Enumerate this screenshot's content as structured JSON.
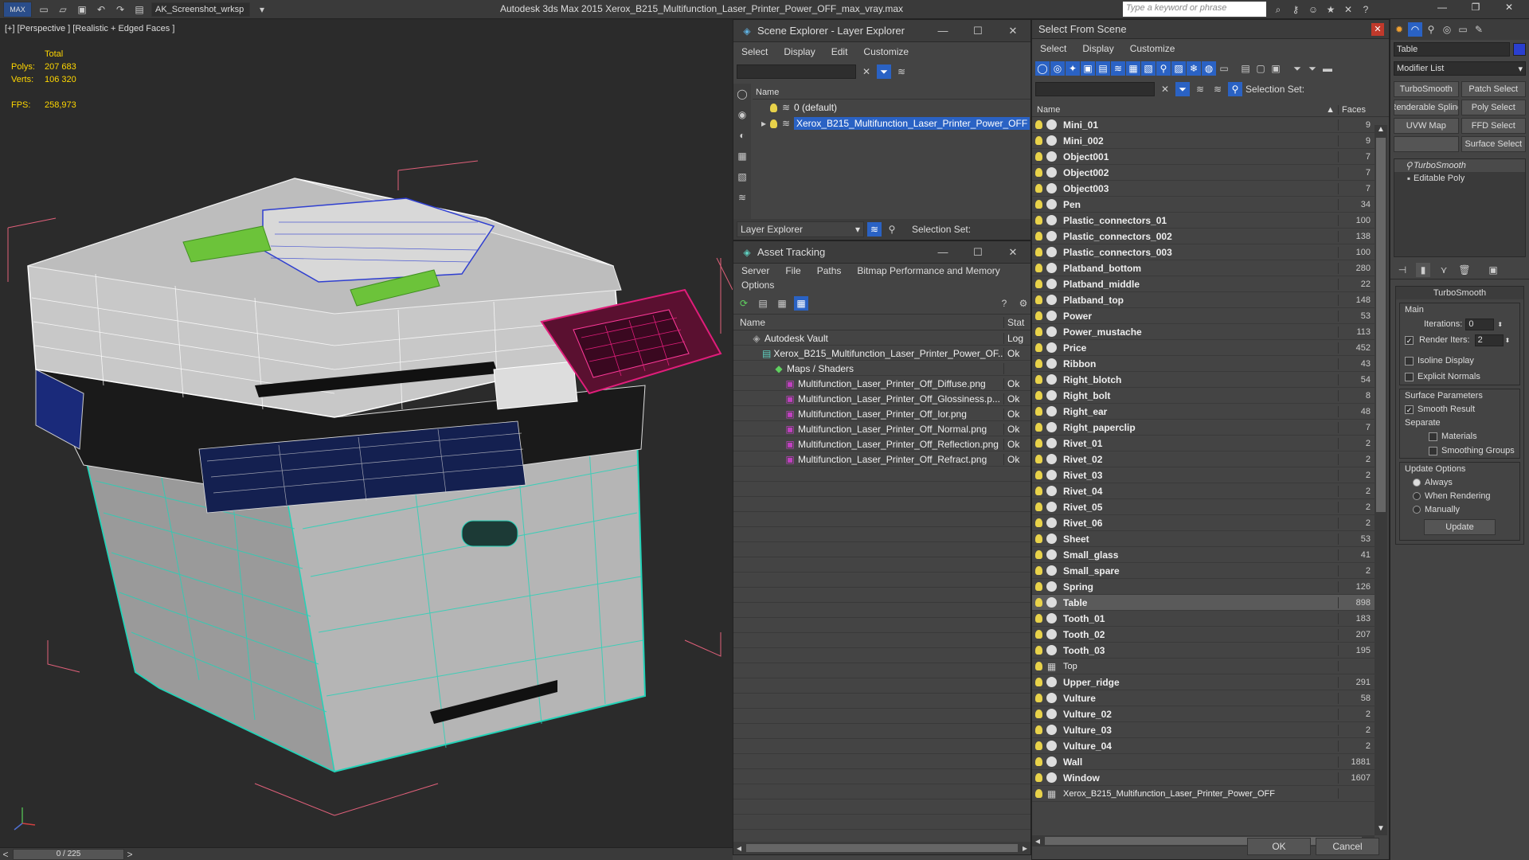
{
  "app": {
    "title": "Autodesk 3ds Max  2015     Xerox_B215_Multifunction_Laser_Printer_Power_OFF_max_vray.max",
    "workspace": "AK_Screenshot_wrksp",
    "search_placeholder": "Type a keyword or phrase"
  },
  "viewport": {
    "label": "[+] [Perspective ] [Realistic + Edged Faces ]",
    "stats": {
      "total_label": "Total",
      "polys_label": "Polys:",
      "polys": "207 683",
      "verts_label": "Verts:",
      "verts": "106 320",
      "fps_label": "FPS:",
      "fps": "258,973"
    },
    "timeline": "0 / 225"
  },
  "scene_explorer": {
    "title": "Scene Explorer - Layer Explorer",
    "menu": [
      "Select",
      "Display",
      "Edit",
      "Customize"
    ],
    "col_name": "Name",
    "rows": [
      {
        "label": "0 (default)",
        "selected": false
      },
      {
        "label": "Xerox_B215_Multifunction_Laser_Printer_Power_OFF",
        "selected": true
      }
    ],
    "footer_dropdown": "Layer Explorer",
    "footer_label": "Selection Set:"
  },
  "asset_tracking": {
    "title": "Asset Tracking",
    "menu": [
      "Server",
      "File",
      "Paths",
      "Bitmap Performance and Memory"
    ],
    "menu2": "Options",
    "col_name": "Name",
    "col_status": "Stat",
    "rows": [
      {
        "label": "Autodesk Vault",
        "status": "Log",
        "indent": 1
      },
      {
        "label": "Xerox_B215_Multifunction_Laser_Printer_Power_OF...",
        "status": "Ok",
        "indent": 2
      },
      {
        "label": "Maps / Shaders",
        "status": "",
        "indent": 3
      },
      {
        "label": "Multifunction_Laser_Printer_Off_Diffuse.png",
        "status": "Ok",
        "indent": 4
      },
      {
        "label": "Multifunction_Laser_Printer_Off_Glossiness.p...",
        "status": "Ok",
        "indent": 4
      },
      {
        "label": "Multifunction_Laser_Printer_Off_Ior.png",
        "status": "Ok",
        "indent": 4
      },
      {
        "label": "Multifunction_Laser_Printer_Off_Normal.png",
        "status": "Ok",
        "indent": 4
      },
      {
        "label": "Multifunction_Laser_Printer_Off_Reflection.png",
        "status": "Ok",
        "indent": 4
      },
      {
        "label": "Multifunction_Laser_Printer_Off_Refract.png",
        "status": "Ok",
        "indent": 4
      }
    ]
  },
  "select_from_scene": {
    "title": "Select From Scene",
    "menu": [
      "Select",
      "Display",
      "Customize"
    ],
    "selection_set_label": "Selection Set:",
    "col_name": "Name",
    "col_faces": "Faces",
    "items": [
      {
        "name": "Mini_01",
        "faces": "9"
      },
      {
        "name": "Mini_002",
        "faces": "9"
      },
      {
        "name": "Object001",
        "faces": "7"
      },
      {
        "name": "Object002",
        "faces": "7"
      },
      {
        "name": "Object003",
        "faces": "7"
      },
      {
        "name": "Pen",
        "faces": "34"
      },
      {
        "name": "Plastic_connectors_01",
        "faces": "100"
      },
      {
        "name": "Plastic_connectors_002",
        "faces": "138"
      },
      {
        "name": "Plastic_connectors_003",
        "faces": "100"
      },
      {
        "name": "Platband_bottom",
        "faces": "280"
      },
      {
        "name": "Platband_middle",
        "faces": "22"
      },
      {
        "name": "Platband_top",
        "faces": "148"
      },
      {
        "name": "Power",
        "faces": "53"
      },
      {
        "name": "Power_mustache",
        "faces": "113"
      },
      {
        "name": "Price",
        "faces": "452"
      },
      {
        "name": "Ribbon",
        "faces": "43"
      },
      {
        "name": "Right_blotch",
        "faces": "54"
      },
      {
        "name": "Right_bolt",
        "faces": "8"
      },
      {
        "name": "Right_ear",
        "faces": "48"
      },
      {
        "name": "Right_paperclip",
        "faces": "7"
      },
      {
        "name": "Rivet_01",
        "faces": "2"
      },
      {
        "name": "Rivet_02",
        "faces": "2"
      },
      {
        "name": "Rivet_03",
        "faces": "2"
      },
      {
        "name": "Rivet_04",
        "faces": "2"
      },
      {
        "name": "Rivet_05",
        "faces": "2"
      },
      {
        "name": "Rivet_06",
        "faces": "2"
      },
      {
        "name": "Sheet",
        "faces": "53"
      },
      {
        "name": "Small_glass",
        "faces": "41"
      },
      {
        "name": "Small_spare",
        "faces": "2"
      },
      {
        "name": "Spring",
        "faces": "126"
      },
      {
        "name": "Table",
        "faces": "898"
      },
      {
        "name": "Tooth_01",
        "faces": "183"
      },
      {
        "name": "Tooth_02",
        "faces": "207"
      },
      {
        "name": "Tooth_03",
        "faces": "195"
      },
      {
        "name": "Top",
        "faces": ""
      },
      {
        "name": "Upper_ridge",
        "faces": "291"
      },
      {
        "name": "Vulture",
        "faces": "58"
      },
      {
        "name": "Vulture_02",
        "faces": "2"
      },
      {
        "name": "Vulture_03",
        "faces": "2"
      },
      {
        "name": "Vulture_04",
        "faces": "2"
      },
      {
        "name": "Wall",
        "faces": "1881"
      },
      {
        "name": "Window",
        "faces": "1607"
      },
      {
        "name": "Xerox_B215_Multifunction_Laser_Printer_Power_OFF",
        "faces": ""
      }
    ],
    "highlighted": "Table",
    "ok_label": "OK",
    "cancel_label": "Cancel"
  },
  "command_panel": {
    "object_name": "Table",
    "modifier_list": "Modifier List",
    "buttons": [
      "TurboSmooth",
      "Patch Select",
      "Renderable Spline",
      "Poly Select",
      "UVW Map",
      "FFD Select",
      "",
      "Surface Select"
    ],
    "stack": [
      "TurboSmooth",
      "Editable Poly"
    ],
    "rollout_title": "TurboSmooth",
    "main_label": "Main",
    "iterations_label": "Iterations:",
    "iterations": "0",
    "render_iters_label": "Render Iters:",
    "render_iters": "2",
    "isoline_label": "Isoline Display",
    "explicit_normals_label": "Explicit Normals",
    "surface_params_label": "Surface Parameters",
    "smooth_result_label": "Smooth Result",
    "separate_label": "Separate",
    "materials_label": "Materials",
    "smoothing_groups_label": "Smoothing Groups",
    "update_options_label": "Update Options",
    "always_label": "Always",
    "when_rendering_label": "When Rendering",
    "manually_label": "Manually",
    "update_label": "Update"
  },
  "colors": {
    "selection": "#2a62c4",
    "stat_text": "#ffd700",
    "printer_lines_cyan": "#22d3b8",
    "panel_wire_pink": "#e01d7a",
    "paper_guides_green": "#6cc33a"
  }
}
